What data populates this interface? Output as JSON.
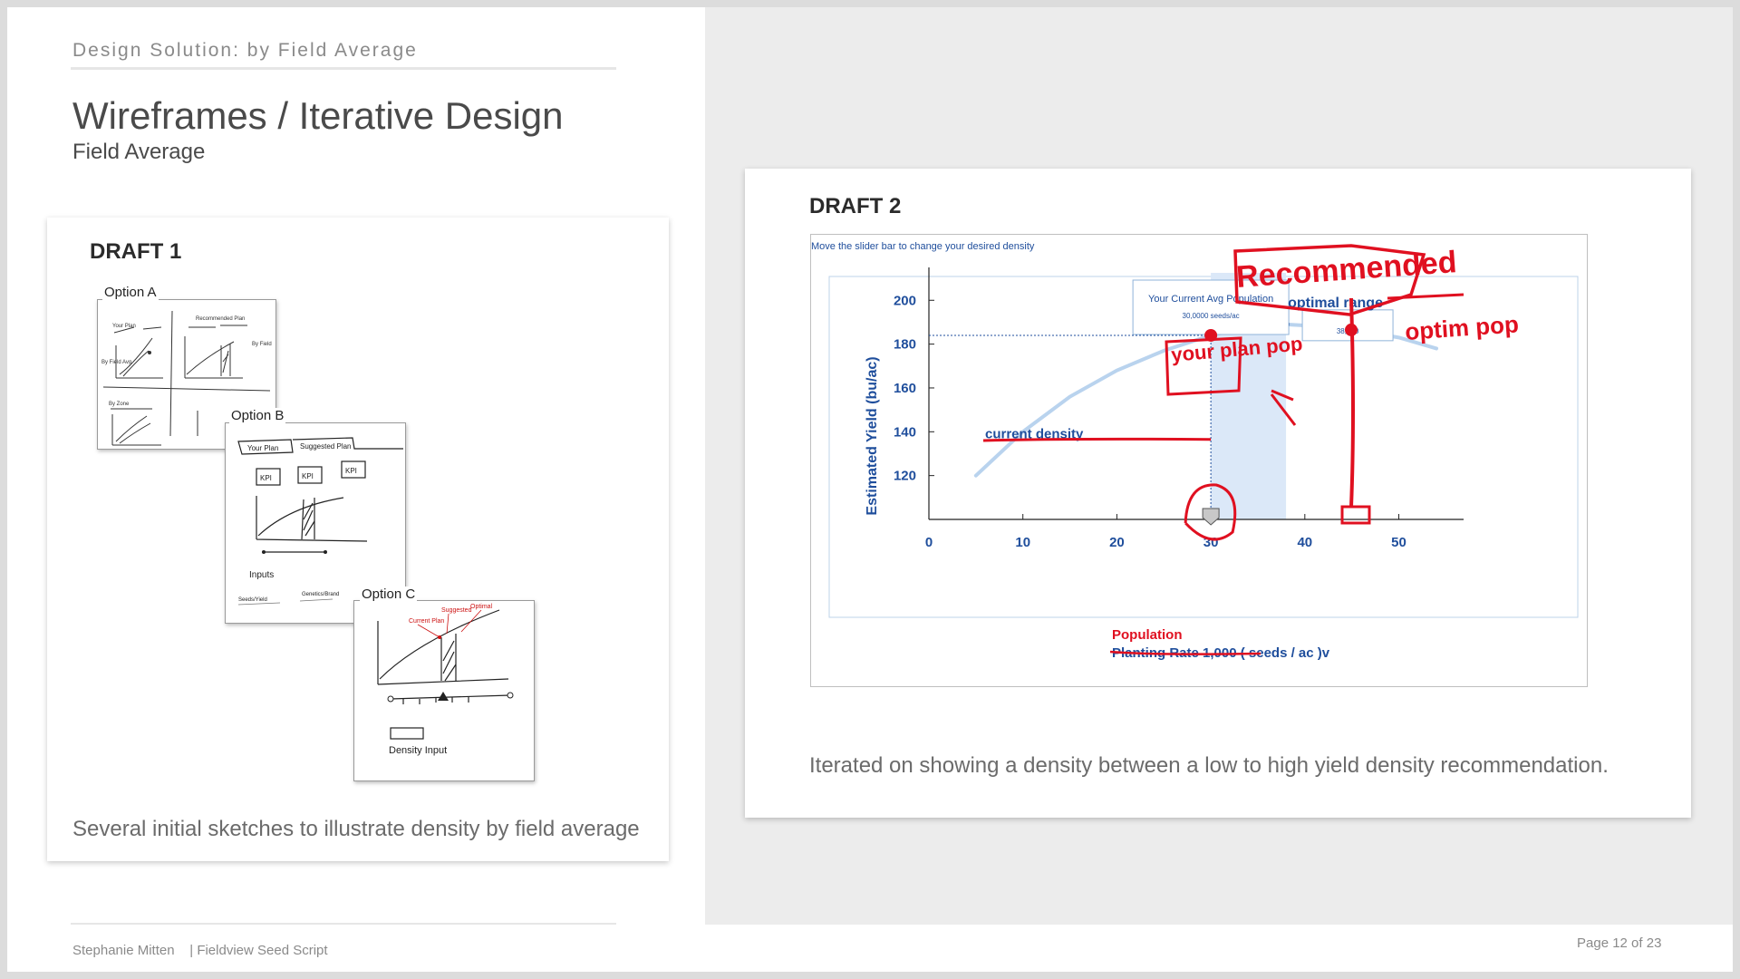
{
  "header": {
    "eyebrow": "Design Solution:  by Field Average",
    "title": "Wireframes / Iterative Design",
    "subtitle": "Field Average"
  },
  "draft1": {
    "label": "DRAFT 1",
    "options": [
      "Option A",
      "Option B",
      "Option C"
    ],
    "caption": "Several initial sketches to illustrate density by field average"
  },
  "draft2": {
    "label": "DRAFT 2",
    "caption": "Iterated on showing a density between a low  to high yield density recommendation."
  },
  "footer": {
    "author": "Stephanie Mitten",
    "project": "| Fieldview Seed Script",
    "page": "Page 12 of 23"
  },
  "chart_data": {
    "type": "line",
    "instruction": "Move the slider bar to change your desired density",
    "xlabel": "Planting Rate 1,000 ( seeds / ac )v",
    "xlabel_annotation": "Population",
    "ylabel": "Estimated Yield  (bu/ac)",
    "x_ticks": [
      0,
      10,
      20,
      30,
      40,
      50
    ],
    "y_ticks": [
      120,
      140,
      160,
      180,
      200
    ],
    "xlim": [
      0,
      54
    ],
    "ylim": [
      100,
      215
    ],
    "series": [
      {
        "x": [
          5,
          10,
          15,
          20,
          25,
          30,
          34,
          38,
          42,
          46,
          50,
          54
        ],
        "y": [
          120,
          140,
          156,
          168,
          177,
          184,
          187.5,
          189,
          188,
          186,
          183,
          178
        ]
      }
    ],
    "optimal_range": [
      30,
      38
    ],
    "optimal_range_label": "optimal range",
    "current_marker": {
      "x": 30,
      "y": 184
    },
    "optimal_marker": {
      "x": 38,
      "y": 189
    },
    "tooltip_current": {
      "title": "Your Current Avg Population",
      "value": "30,0000 seeds/ac"
    },
    "tooltip_optimal": {
      "value": "38,000"
    },
    "current_density_label": "current density",
    "annotations": [
      "Recommended",
      "your plan pop",
      "optim pop"
    ],
    "colors": {
      "axis": "#1f4e9c",
      "curve": "#b9d3ee",
      "range": "#dbe8f8",
      "annotation": "#e01020"
    }
  }
}
